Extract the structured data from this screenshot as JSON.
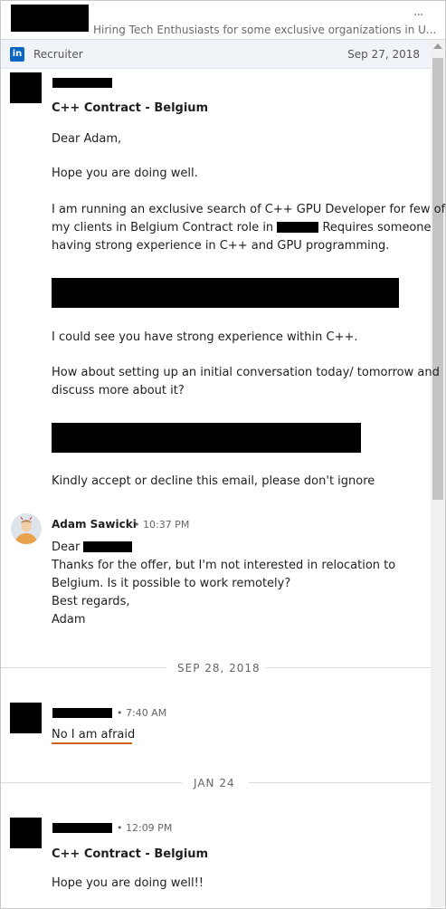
{
  "header": {
    "subject": "Hiring Tech Enthusiasts for some exclusive organizations in U...",
    "more": "···"
  },
  "banner": {
    "label": "Recruiter",
    "date": "Sep 27, 2018",
    "logo": "in"
  },
  "msg1": {
    "subject": "C++ Contract - Belgium",
    "greeting": "Dear Adam,",
    "p1": "Hope you are doing well.",
    "p2_l1": "I am running an exclusive search of C++ GPU Developer for few of",
    "p2_l2a": "my clients in Belgium Contract role in",
    "p2_l2b": "Requires someone",
    "p2_l3": "having strong experience in C++ and GPU programming.",
    "p3": "I could see you have strong experience within C++.",
    "p4_l1": "How about setting up an initial conversation today/ tomorrow and",
    "p4_l2": "discuss more about it?",
    "p5": "Kindly accept or decline this email, please don't ignore"
  },
  "msg2": {
    "sender": "Adam Sawicki",
    "time": "• 10:37 PM",
    "l1": "Dear",
    "l2": "Thanks for the offer, but I'm not interested in relocation to",
    "l3": "Belgium. Is it possible to work remotely?",
    "l4": "Best regards,",
    "l5": "Adam"
  },
  "divider1": "SEP 28, 2018",
  "msg3": {
    "time": "• 7:40 AM",
    "text": "No I am afraid"
  },
  "divider2": "JAN 24",
  "msg4": {
    "time": "• 12:09 PM",
    "subject": "C++ Contract - Belgium",
    "text": "Hope you are doing well!!"
  }
}
